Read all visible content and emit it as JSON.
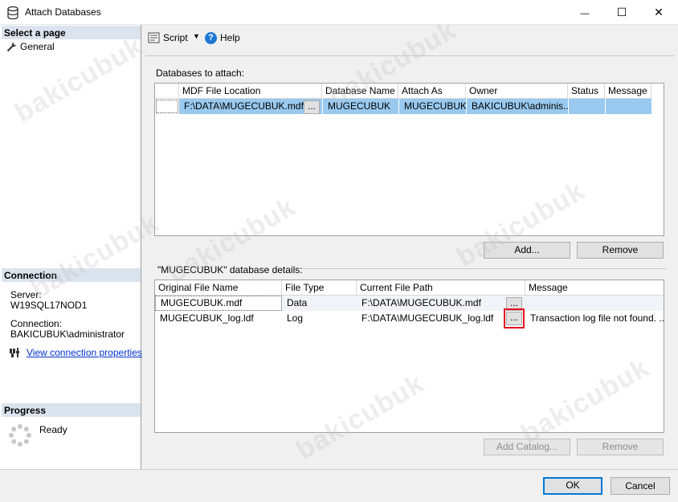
{
  "window": {
    "title": "Attach Databases",
    "minimize_glyph": "—",
    "maximize_glyph": "☐",
    "close_glyph": "✕"
  },
  "left": {
    "select_page_header": "Select a page",
    "pages": [
      {
        "label": "General",
        "icon": "wrench-icon"
      }
    ],
    "connection_header": "Connection",
    "server_label": "Server:",
    "server_value": "W19SQL17NOD1",
    "connection_label": "Connection:",
    "connection_value": "BAKICUBUK\\administrator",
    "view_connection_link": "View connection properties",
    "progress_header": "Progress",
    "progress_status": "Ready"
  },
  "toolbar": {
    "script_label": "Script",
    "help_label": "Help"
  },
  "attach": {
    "section_label": "Databases to attach:",
    "columns": [
      "MDF File Location",
      "Database Name",
      "Attach As",
      "Owner",
      "Status",
      "Message"
    ],
    "rows": [
      {
        "mdf_location": "F:\\DATA\\MUGECUBUK.mdf",
        "database_name": "MUGECUBUK",
        "attach_as": "MUGECUBUK",
        "owner": "BAKICUBUK\\adminis...",
        "status": "",
        "message": ""
      }
    ],
    "browse_label": "...",
    "add_button": "Add...",
    "remove_button": "Remove"
  },
  "details": {
    "section_label": "\"MUGECUBUK\" database details:",
    "columns": [
      "Original File Name",
      "File Type",
      "Current File Path",
      "Message"
    ],
    "rows": [
      {
        "original": "MUGECUBUK.mdf",
        "type": "Data",
        "path": "F:\\DATA\\MUGECUBUK.mdf",
        "message": ""
      },
      {
        "original": "MUGECUBUK_log.ldf",
        "type": "Log",
        "path": "F:\\DATA\\MUGECUBUK_log.ldf",
        "message": "Transaction log file not found. ..."
      }
    ],
    "browse_label": "...",
    "add_catalog_button": "Add Catalog...",
    "remove_button": "Remove"
  },
  "footer": {
    "ok_button": "OK",
    "cancel_button": "Cancel"
  },
  "watermark": "bakicubuk",
  "colors": {
    "section_header_bg": "#dbe3ee",
    "selected_row_bg": "#99c9ef",
    "highlight_box": "#e81123",
    "link": "#0033cc"
  }
}
